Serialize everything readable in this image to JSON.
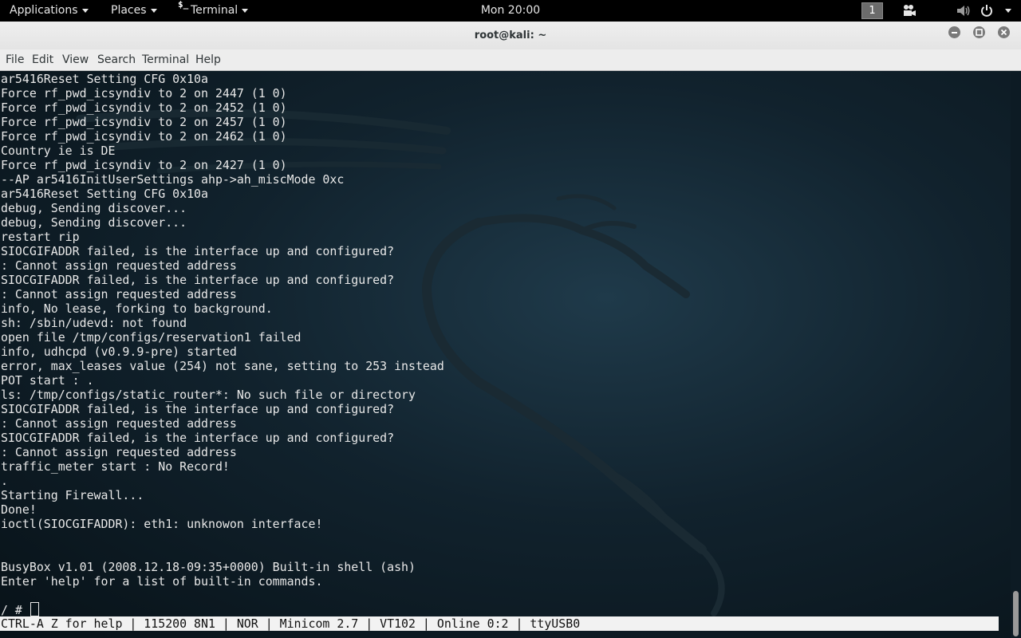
{
  "top_panel": {
    "applications_label": "Applications",
    "places_label": "Places",
    "terminal_app_icon_text": "$_",
    "terminal_app_label": "Terminal",
    "clock": "Mon 20:00",
    "workspace_number": "1"
  },
  "window": {
    "title": "root@kali: ~"
  },
  "menubar": {
    "file": "File",
    "edit": "Edit",
    "view": "View",
    "search": "Search",
    "terminal": "Terminal",
    "help": "Help"
  },
  "terminal": {
    "lines": [
      "ar5416Reset Setting CFG 0x10a",
      "Force rf_pwd_icsyndiv to 2 on 2447 (1 0)",
      "Force rf_pwd_icsyndiv to 2 on 2452 (1 0)",
      "Force rf_pwd_icsyndiv to 2 on 2457 (1 0)",
      "Force rf_pwd_icsyndiv to 2 on 2462 (1 0)",
      "Country ie is DE",
      "Force rf_pwd_icsyndiv to 2 on 2427 (1 0)",
      "--AP ar5416InitUserSettings ahp->ah_miscMode 0xc",
      "ar5416Reset Setting CFG 0x10a",
      "debug, Sending discover...",
      "debug, Sending discover...",
      "restart rip",
      "SIOCGIFADDR failed, is the interface up and configured?",
      ": Cannot assign requested address",
      "SIOCGIFADDR failed, is the interface up and configured?",
      ": Cannot assign requested address",
      "info, No lease, forking to background.",
      "sh: /sbin/udevd: not found",
      "open file /tmp/configs/reservation1 failed",
      "info, udhcpd (v0.9.9-pre) started",
      "error, max_leases value (254) not sane, setting to 253 instead",
      "POT start : .",
      "ls: /tmp/configs/static_router*: No such file or directory",
      "SIOCGIFADDR failed, is the interface up and configured?",
      ": Cannot assign requested address",
      "SIOCGIFADDR failed, is the interface up and configured?",
      ": Cannot assign requested address",
      "traffic_meter start : No Record!",
      ".",
      "Starting Firewall...",
      "Done!",
      "ioctl(SIOCGIFADDR): eth1: unknowon interface!",
      "",
      "",
      "BusyBox v1.01 (2008.12.18-09:35+0000) Built-in shell (ash)",
      "Enter 'help' for a list of built-in commands."
    ],
    "prompt": "/ # ",
    "status_line": "CTRL-A Z for help | 115200 8N1 | NOR | Minicom 2.7 | VT102 | Online 0:2 | ttyUSB0"
  },
  "icons": {
    "panel": [
      "camera-icon",
      "volume-icon",
      "power-icon"
    ],
    "window": [
      "minimize-icon",
      "maximize-icon",
      "close-icon"
    ]
  },
  "colors": {
    "panel_bg": "#000000",
    "titlebar_bg": "#e8e8e8",
    "terminal_fg": "#e8e8e8",
    "terminal_bg": "#11222d",
    "status_bg": "#f2f2f2"
  }
}
